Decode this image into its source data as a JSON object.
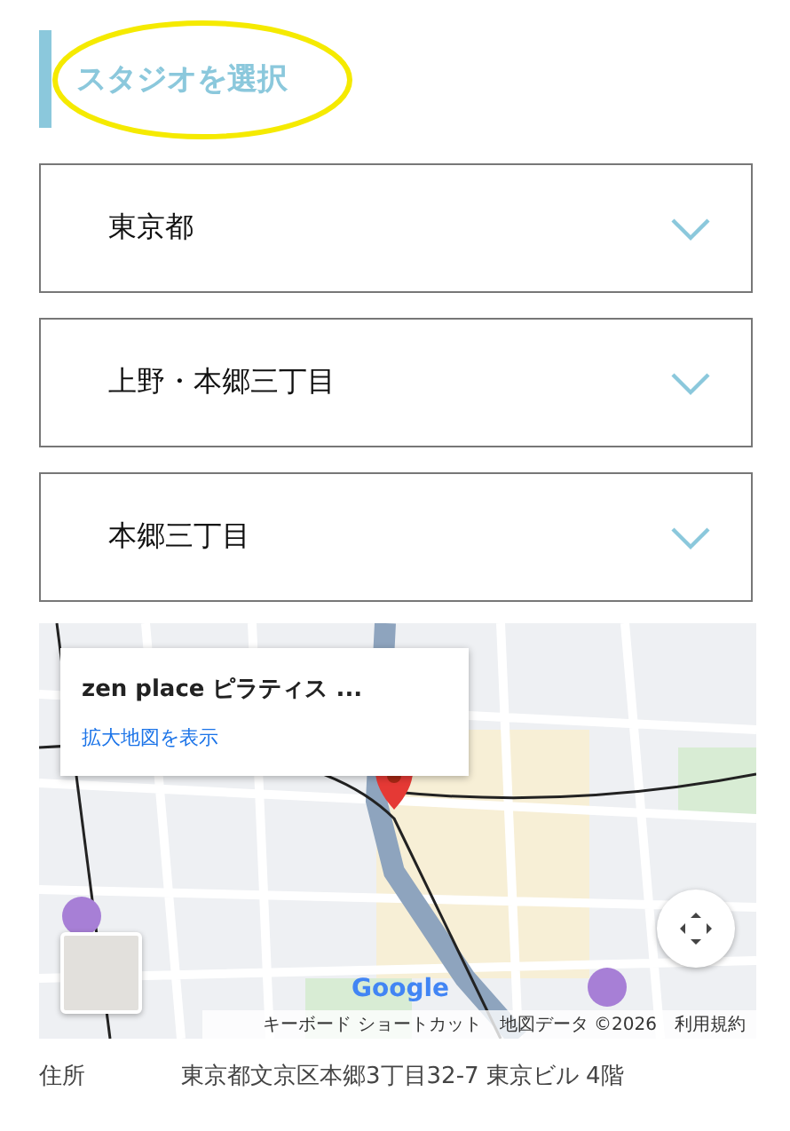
{
  "section_title": "スタジオを選択",
  "selects": [
    {
      "value": "東京都"
    },
    {
      "value": "上野・本郷三丁目"
    },
    {
      "value": "本郷三丁目"
    }
  ],
  "map": {
    "kind": "picture",
    "info_card": {
      "title": "zen place ピラティス ...",
      "link": "拡大地図を表示"
    },
    "logo": "Google",
    "attribution": [
      "キーボード ショートカット",
      "地図データ ©2026",
      "利用規約"
    ]
  },
  "address": {
    "label": "住所",
    "value": "東京都文京区本郷3丁目32-7 東京ビル 4階"
  }
}
